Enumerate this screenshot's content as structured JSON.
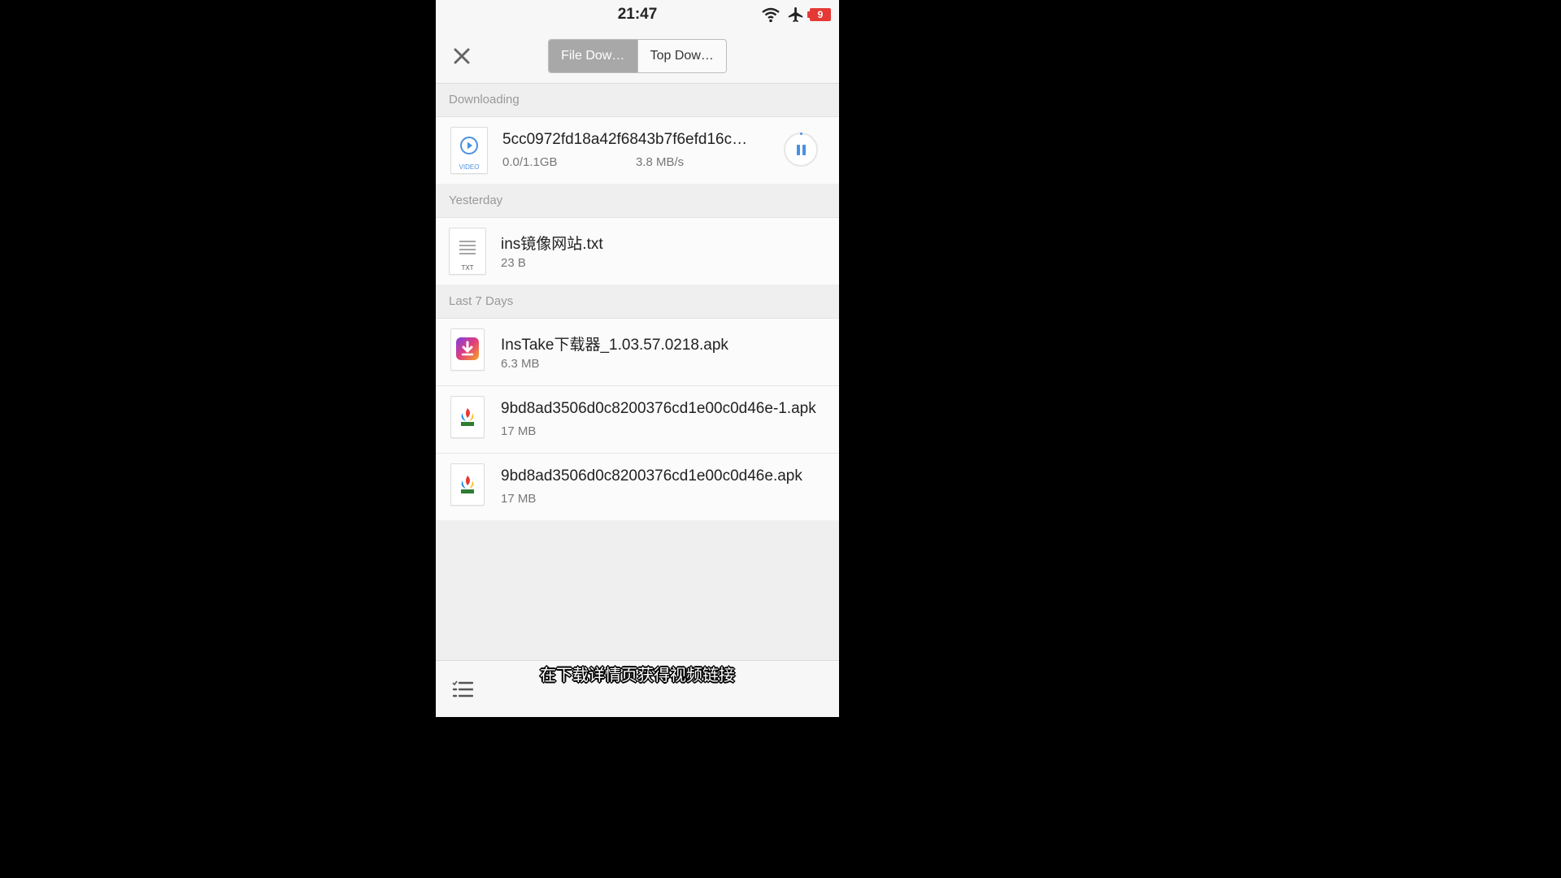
{
  "status": {
    "time": "21:47",
    "battery": "9"
  },
  "tabs": [
    {
      "label": "File Dow…",
      "active": true
    },
    {
      "label": "Top Dow…",
      "active": false
    }
  ],
  "sections": {
    "downloading": "Downloading",
    "yesterday": "Yesterday",
    "last7": "Last 7 Days"
  },
  "downloading": {
    "name": "5cc0972fd18a42f6843b7f6efd16c…",
    "progress": "0.0/1.1GB",
    "speed": "3.8 MB/s",
    "type_label": "VIDEO"
  },
  "yesterday": [
    {
      "name": "ins镜像网站.txt",
      "size": "23 B",
      "type_label": "TXT"
    }
  ],
  "last7": [
    {
      "name": "InsTake下载器_1.03.57.0218.apk",
      "size": "6.3 MB"
    },
    {
      "name": "9bd8ad3506d0c8200376cd1e00c0d46e-1.apk",
      "size": "17 MB"
    },
    {
      "name": "9bd8ad3506d0c8200376cd1e00c0d46e.apk",
      "size": "17 MB"
    }
  ],
  "subtitle": "在下载详情页获得视频链接",
  "colors": {
    "accent": "#4a90e2",
    "battery": "#e53935"
  }
}
